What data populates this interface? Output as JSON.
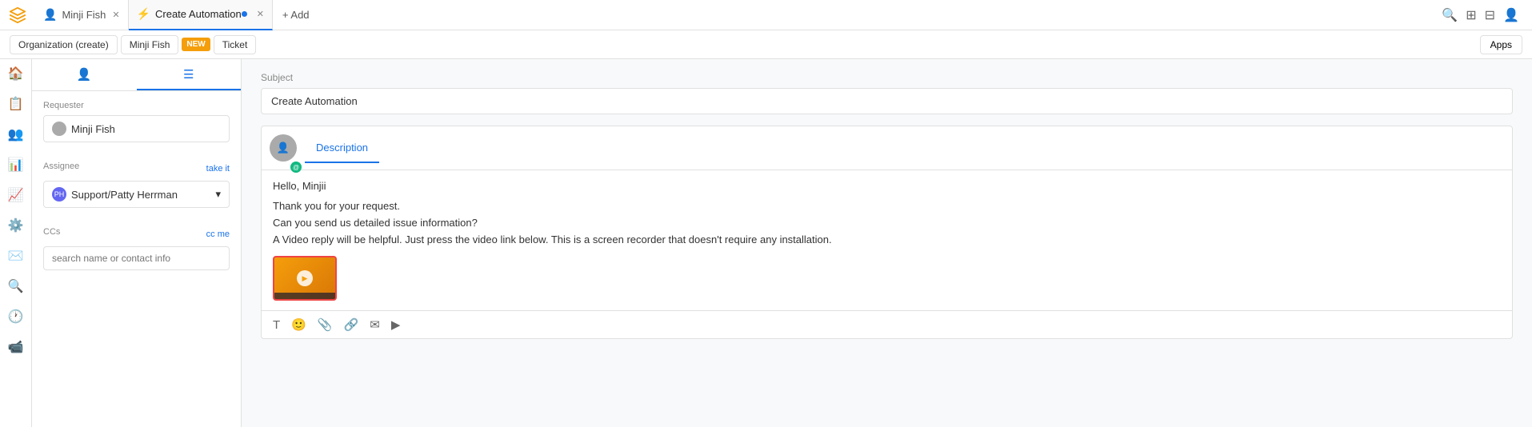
{
  "topBar": {
    "tabs": [
      {
        "id": "minji-fish",
        "label": "Minji Fish",
        "icon": "👤",
        "active": false,
        "closable": true,
        "hasDot": false
      },
      {
        "id": "create-automation",
        "label": "Create Automation",
        "icon": "⚡",
        "active": true,
        "closable": true,
        "hasDot": true
      }
    ],
    "addLabel": "+ Add"
  },
  "breadcrumb": {
    "items": [
      {
        "id": "org-create",
        "label": "Organization (create)"
      },
      {
        "id": "minji-fish",
        "label": "Minji Fish"
      }
    ],
    "newBadge": "NEW",
    "ticketLabel": "Ticket",
    "appsLabel": "Apps"
  },
  "leftNav": {
    "icons": [
      {
        "id": "home",
        "symbol": "🏠",
        "active": false
      },
      {
        "id": "inbox",
        "symbol": "📋",
        "active": false
      },
      {
        "id": "contacts",
        "symbol": "👥",
        "active": false
      },
      {
        "id": "reports",
        "symbol": "📊",
        "active": false
      },
      {
        "id": "analytics",
        "symbol": "📈",
        "active": false
      },
      {
        "id": "settings",
        "symbol": "⚙️",
        "active": false
      },
      {
        "id": "mail",
        "symbol": "✉️",
        "active": false
      },
      {
        "id": "search",
        "symbol": "🔍",
        "active": false
      },
      {
        "id": "clock",
        "symbol": "🕐",
        "active": false
      },
      {
        "id": "video",
        "symbol": "📹",
        "active": false
      }
    ]
  },
  "panel": {
    "tabs": [
      {
        "id": "person",
        "symbol": "👤",
        "active": false
      },
      {
        "id": "details",
        "symbol": "☰",
        "active": true
      }
    ],
    "requester": {
      "label": "Requester",
      "value": "Minji Fish"
    },
    "assignee": {
      "label": "Assignee",
      "takeLabel": "take it",
      "value": "Support/Patty Herrman",
      "initials": "PH"
    },
    "ccs": {
      "label": "CCs",
      "ccMeLabel": "cc me",
      "placeholder": "search name or contact info"
    }
  },
  "editor": {
    "subjectLabel": "Subject",
    "subjectValue": "Create Automation",
    "tabs": [
      {
        "id": "description",
        "label": "Description",
        "active": true
      }
    ],
    "greeting": "Hello, Minjii",
    "bodyLines": [
      "Thank you for your request.",
      "Can you send us detailed issue information?",
      "A Video reply will be helpful. Just press the video link below. This is a screen recorder that doesn't require any installation."
    ],
    "toolbar": {
      "icons": [
        {
          "id": "text",
          "symbol": "T"
        },
        {
          "id": "emoji",
          "symbol": "🙂"
        },
        {
          "id": "attach",
          "symbol": "📎"
        },
        {
          "id": "link",
          "symbol": "🔗"
        },
        {
          "id": "email",
          "symbol": "✉"
        },
        {
          "id": "video",
          "symbol": "▶"
        }
      ]
    }
  }
}
